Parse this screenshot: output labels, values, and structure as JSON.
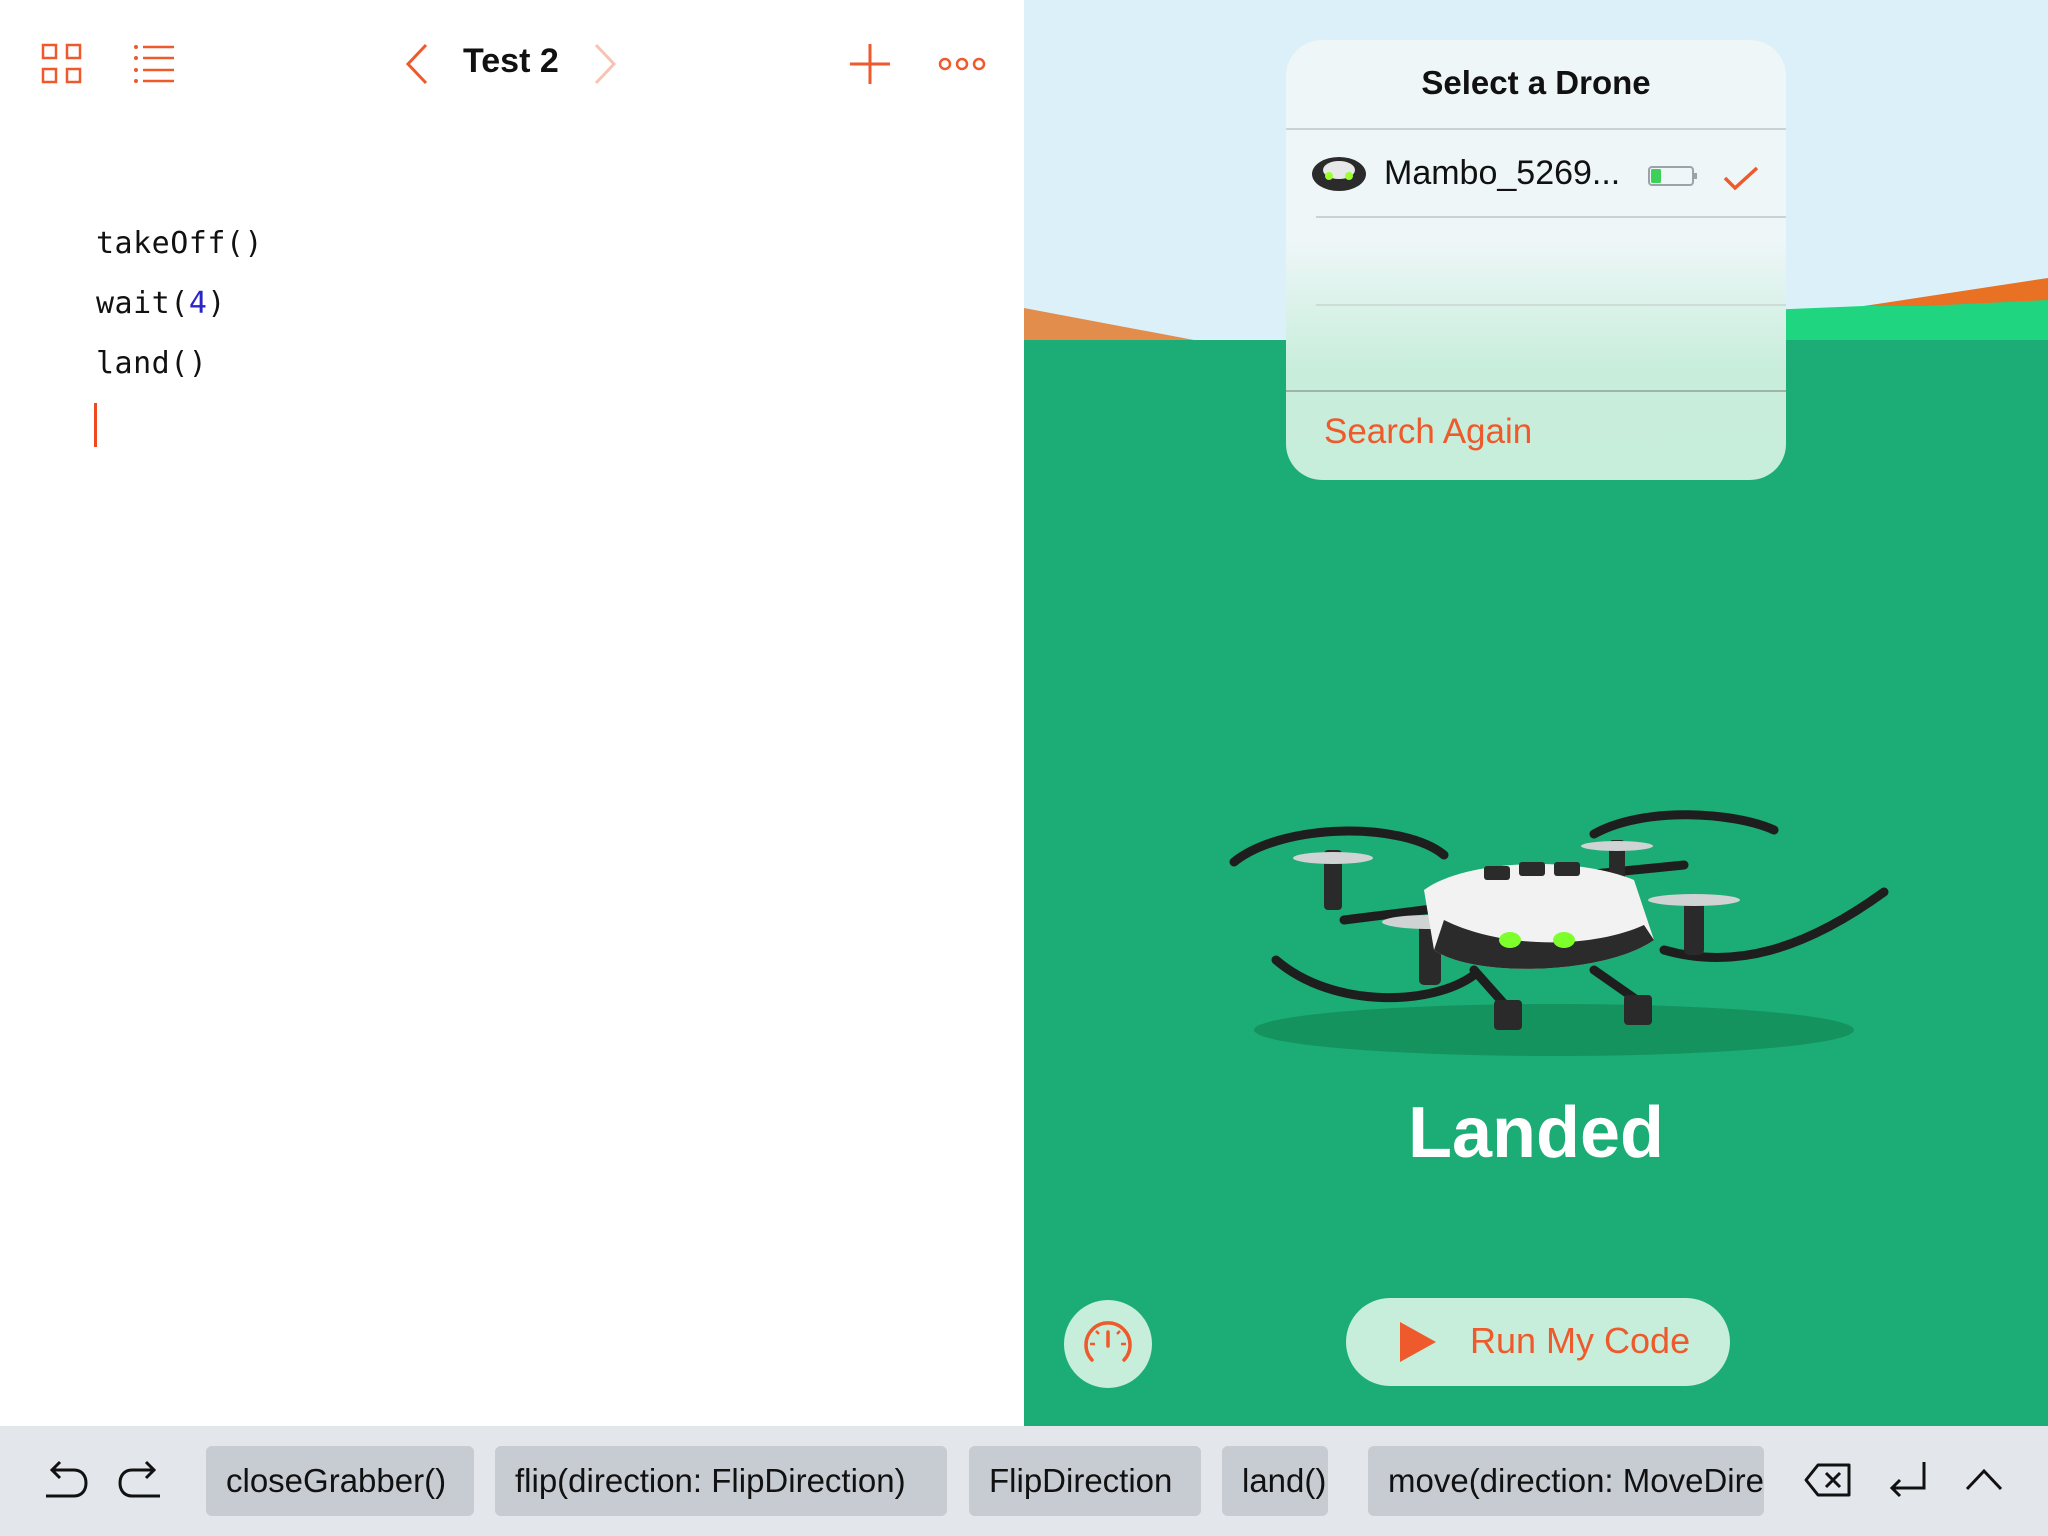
{
  "editor": {
    "title": "Test 2",
    "code_lines": {
      "line1": "takeOff()",
      "line2_fn": "wait(",
      "line2_arg": "4",
      "line2_end": ")",
      "line3": "land()"
    }
  },
  "liveview": {
    "drone_picker": {
      "title": "Select a Drone",
      "drone_name": "Mambo_5269...",
      "battery_level": 0.25,
      "selected": true,
      "search_again_label": "Search Again"
    },
    "status": "Landed",
    "run_button_label": "Run My Code"
  },
  "shortcut_bar": {
    "chips": [
      "closeGrabber()",
      "flip(direction: FlipDirection)",
      "FlipDirection",
      "land()",
      "move(direction: MoveDirection)"
    ]
  },
  "colors": {
    "accent": "#ee5a2c",
    "ground_green": "#1cac75",
    "sky": "#dcf0fa",
    "chip_bg": "#c7cbd2",
    "number_literal": "#2a23c8"
  },
  "icons": {
    "grid": "grid-icon",
    "list": "list-icon",
    "prev": "chevron-left-icon",
    "next": "chevron-right-icon",
    "add": "plus-icon",
    "more": "more-icon",
    "undo": "undo-icon",
    "redo": "redo-icon",
    "delete": "delete-icon",
    "return": "return-icon",
    "hide": "chevron-up-icon",
    "speed": "speedometer-icon",
    "play": "play-icon",
    "check": "checkmark-icon"
  }
}
